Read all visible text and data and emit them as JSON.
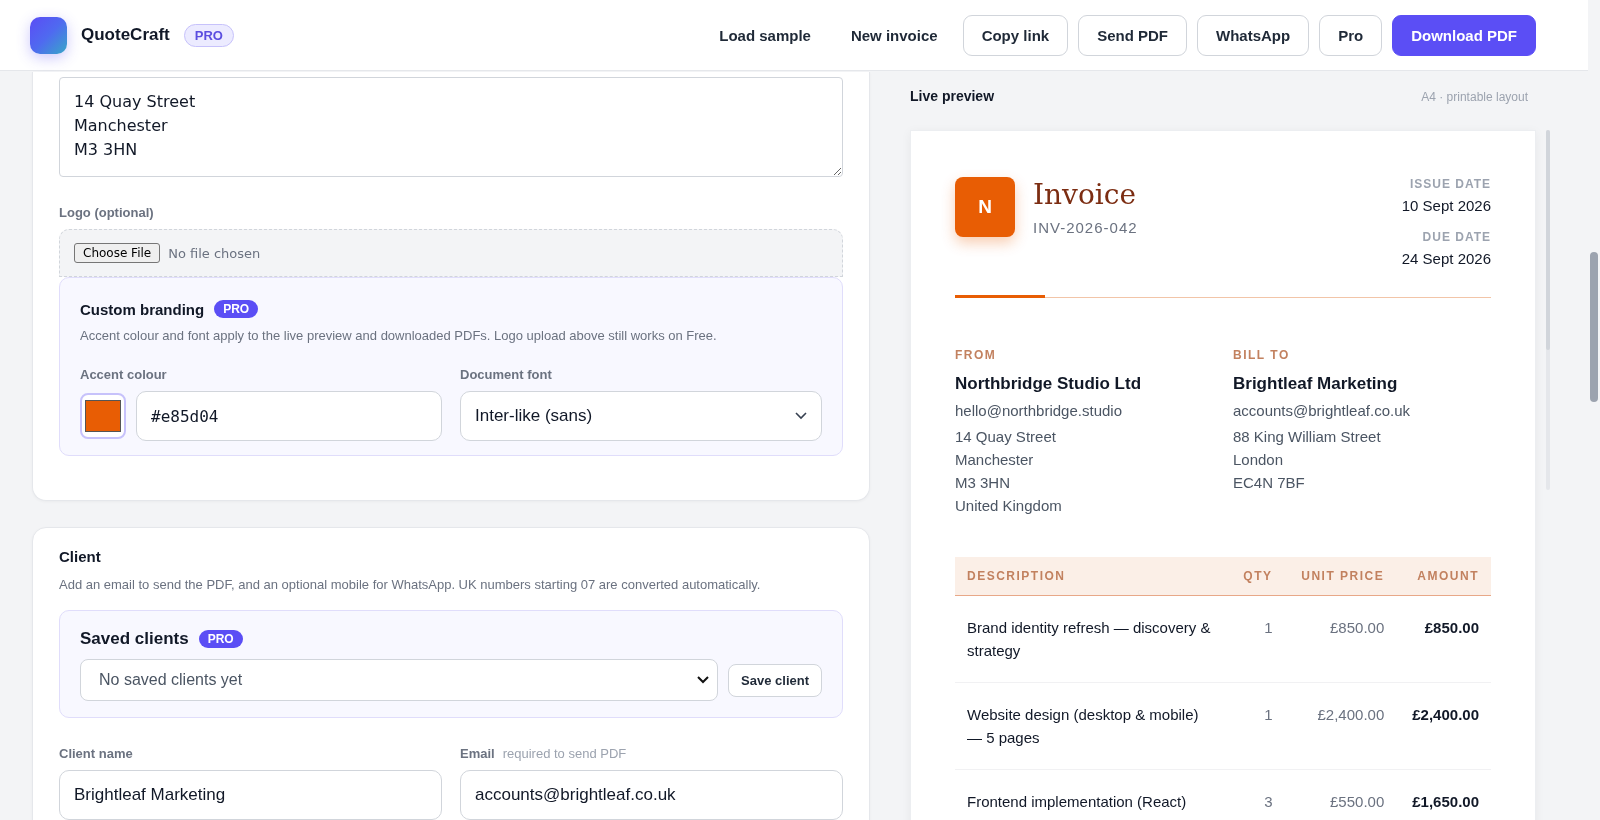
{
  "header": {
    "brand": "QuoteCraft",
    "badge": "PRO",
    "actions": [
      {
        "label": "Load sample",
        "kind": "text"
      },
      {
        "label": "New invoice",
        "kind": "text"
      },
      {
        "label": "Copy link",
        "kind": "outline"
      },
      {
        "label": "Send PDF",
        "kind": "outline"
      },
      {
        "label": "WhatsApp",
        "kind": "outline"
      },
      {
        "label": "Pro",
        "kind": "outline"
      },
      {
        "label": "Download PDF",
        "kind": "primary"
      }
    ]
  },
  "business": {
    "address_value": "14 Quay Street\nManchester\nM3 3HN",
    "logo_label": "Logo (optional)",
    "file_button": "Choose File",
    "file_status": "No file chosen"
  },
  "branding": {
    "title": "Custom branding",
    "badge": "PRO",
    "description": "Accent colour and font apply to the live preview and downloaded PDFs. Logo upload above still works on Free.",
    "accent_label": "Accent colour",
    "accent_value": "#e85d04",
    "font_label": "Document font",
    "font_value": "Inter-like (sans)"
  },
  "client": {
    "title": "Client",
    "description": "Add an email to send the PDF, and an optional mobile for WhatsApp. UK numbers starting 07 are converted automatically.",
    "saved_title": "Saved clients",
    "saved_badge": "PRO",
    "saved_placeholder": "No saved clients yet",
    "save_button": "Save client",
    "name_label": "Client name",
    "name_value": "Brightleaf Marketing",
    "email_label": "Email",
    "email_hint": "required to send PDF",
    "email_value": "accounts@brightleaf.co.uk"
  },
  "preview": {
    "title": "Live preview",
    "note": "A4 · printable layout",
    "invoice": {
      "logo_letter": "N",
      "title": "Invoice",
      "number": "INV-2026-042",
      "issue_label": "ISSUE DATE",
      "issue_date": "10 Sept 2026",
      "due_label": "DUE DATE",
      "due_date": "24 Sept 2026",
      "from": {
        "label": "FROM",
        "name": "Northbridge Studio Ltd",
        "email": "hello@northbridge.studio",
        "lines": [
          "14 Quay Street",
          "Manchester",
          "M3 3HN",
          "United Kingdom"
        ]
      },
      "bill_to": {
        "label": "BILL TO",
        "name": "Brightleaf Marketing",
        "email": "accounts@brightleaf.co.uk",
        "lines": [
          "88 King William Street",
          "London",
          "EC4N 7BF"
        ]
      },
      "columns": [
        "DESCRIPTION",
        "QTY",
        "UNIT PRICE",
        "AMOUNT"
      ],
      "rows": [
        {
          "description": "Brand identity refresh — discovery & strategy",
          "qty": "1",
          "unit_price": "£850.00",
          "amount": "£850.00"
        },
        {
          "description": "Website design (desktop & mobile) — 5 pages",
          "qty": "1",
          "unit_price": "£2,400.00",
          "amount": "£2,400.00"
        },
        {
          "description": "Frontend implementation (React)",
          "qty": "3",
          "unit_price": "£550.00",
          "amount": "£1,650.00"
        }
      ]
    }
  }
}
